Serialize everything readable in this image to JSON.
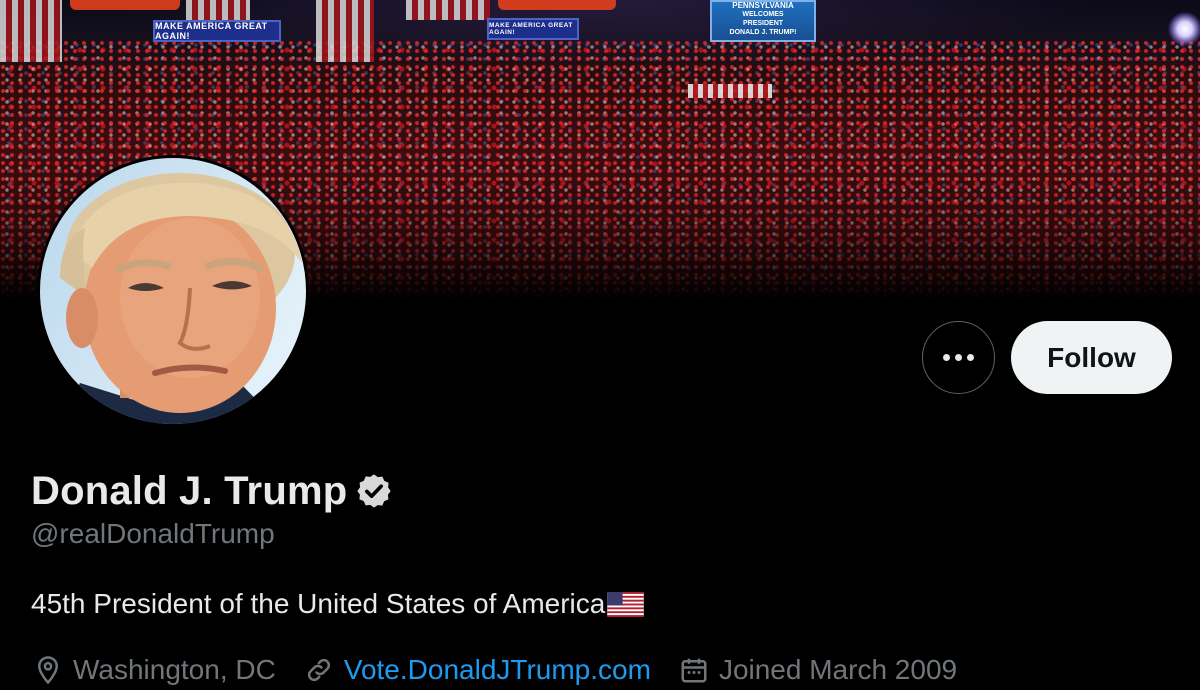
{
  "banner": {
    "signs": [
      "MAKE AMERICA GREAT AGAIN!",
      "MAKE AMERICA GREAT AGAIN!"
    ],
    "jumbotron_lines": [
      "PENNSYLVANIA",
      "WELCOMES",
      "PRESIDENT",
      "DONALD J. TRUMP!"
    ]
  },
  "profile": {
    "display_name": "Donald J. Trump",
    "handle": "@realDonaldTrump",
    "bio": "45th President of the United States of America",
    "bio_emoji": "us-flag-icon",
    "verified": true,
    "location": "Washington, DC",
    "website": "Vote.DonaldJTrump.com",
    "joined": "Joined March 2009"
  },
  "actions": {
    "more_icon": "more-icon",
    "follow_label": "Follow"
  },
  "colors": {
    "background": "#000000",
    "text_primary": "#e7e9ea",
    "text_secondary": "#71767b",
    "link": "#1d9bf0",
    "follow_button_bg": "#eff3f4",
    "verified_badge": "#d9d9d9"
  }
}
